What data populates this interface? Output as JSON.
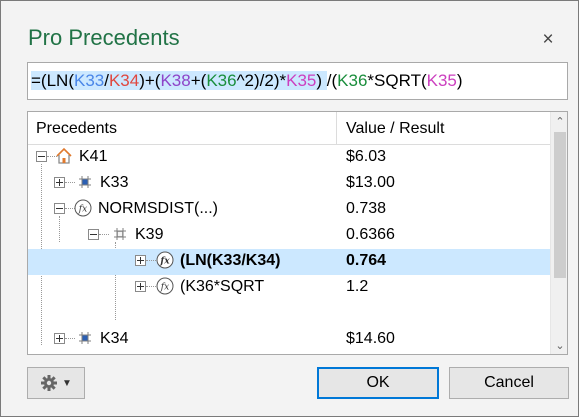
{
  "dialog": {
    "title": "Pro Precedents",
    "close_glyph": "×"
  },
  "formula": {
    "parts": [
      {
        "t": "=(LN(",
        "c": "#000000"
      },
      {
        "t": "K33",
        "c": "#4a86e8"
      },
      {
        "t": "/",
        "c": "#000000"
      },
      {
        "t": "K34",
        "c": "#e0473f"
      },
      {
        "t": ")+(",
        "c": "#000000"
      },
      {
        "t": "K38",
        "c": "#8e44c8"
      },
      {
        "t": "+(",
        "c": "#000000"
      },
      {
        "t": "K36",
        "c": "#1a8e3c"
      },
      {
        "t": "^2)/2)*",
        "c": "#000000"
      },
      {
        "t": "K35",
        "c": "#cc3fbf"
      },
      {
        "t": ")",
        "c": "#000000"
      },
      {
        "t": "/(",
        "c": "#000000"
      },
      {
        "t": "K36",
        "c": "#1a8e3c"
      },
      {
        "t": "*SQRT(",
        "c": "#000000"
      },
      {
        "t": "K35",
        "c": "#cc3fbf"
      },
      {
        "t": ")",
        "c": "#000000"
      }
    ]
  },
  "grid": {
    "col_precedents": "Precedents",
    "col_value": "Value / Result",
    "rows": [
      {
        "icon": "home-icon",
        "label": "K41",
        "value": "$6.03"
      },
      {
        "icon": "cell-icon",
        "label": "K33",
        "value": "$13.00"
      },
      {
        "icon": "function-icon",
        "label": "NORMSDIST(...)",
        "value": "0.738"
      },
      {
        "icon": "cell-icon",
        "label": "K39",
        "value": "0.6366"
      },
      {
        "icon": "function-icon",
        "label": "(LN(K33/K34)",
        "value": "0.764"
      },
      {
        "icon": "function-icon",
        "label": "(K36*SQRT",
        "value": "1.2"
      },
      {
        "icon": "cell-icon",
        "label": "K34",
        "value": "$14.60"
      }
    ]
  },
  "footer": {
    "ok_label": "OK",
    "cancel_label": "Cancel",
    "settings_icon": "gear-icon"
  },
  "colors": {
    "title": "#217346",
    "selection": "#cce8ff",
    "home_icon": "#e07a2e"
  }
}
